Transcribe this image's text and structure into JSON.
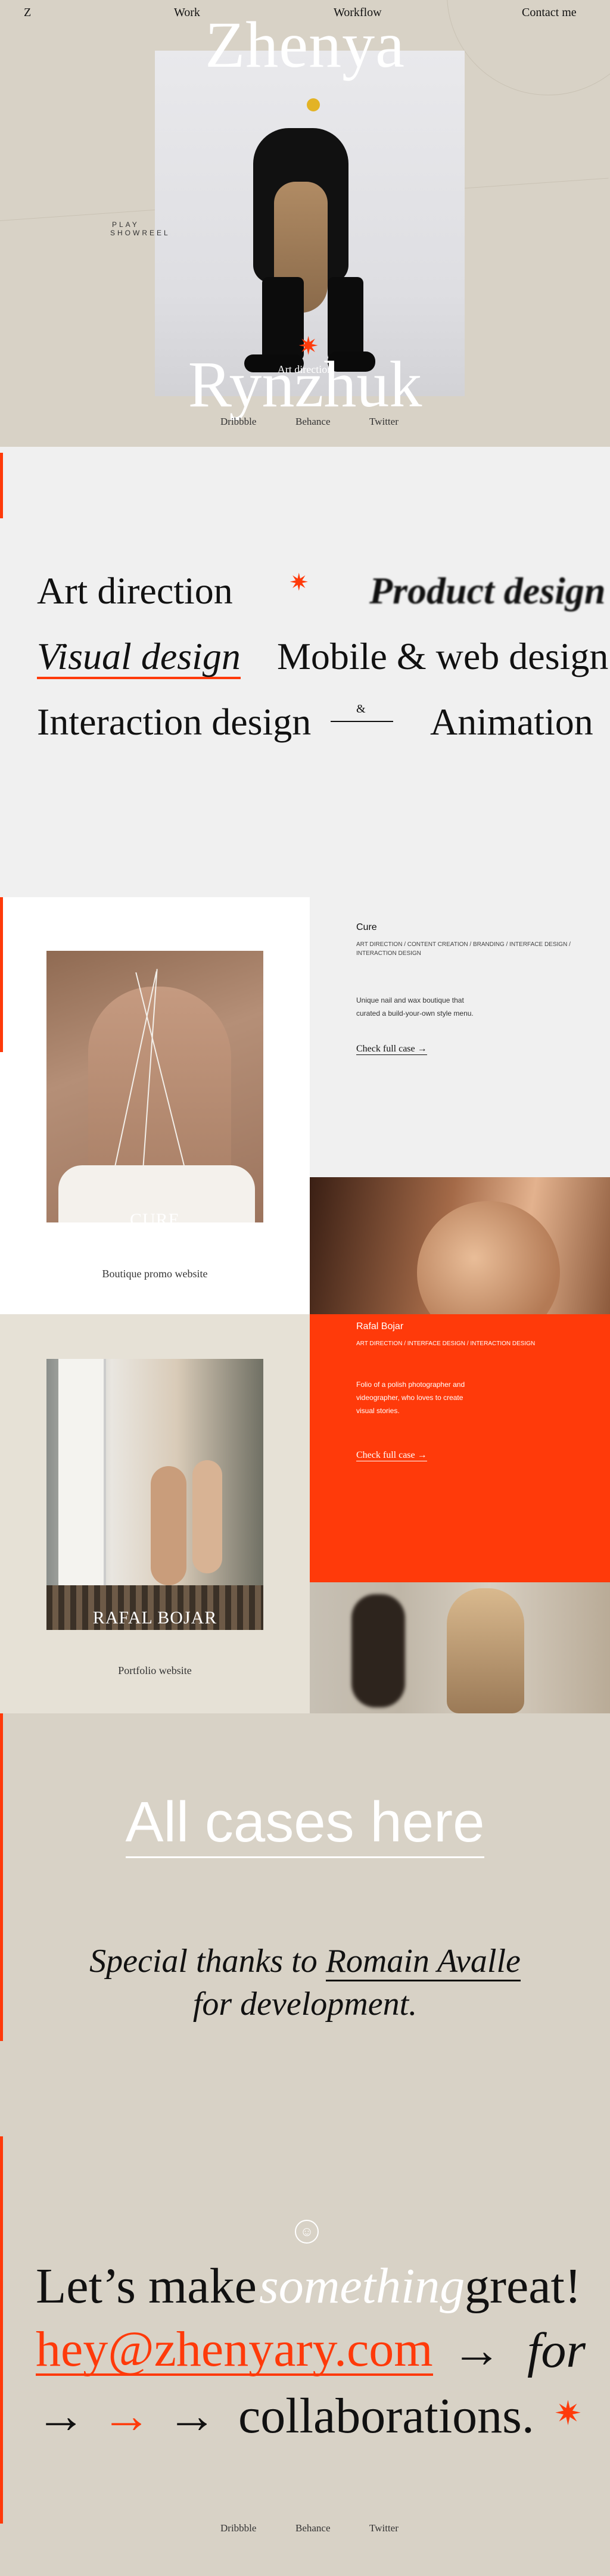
{
  "nav": {
    "logo": "Z",
    "work": "Work",
    "workflow": "Workflow",
    "contact": "Contact me"
  },
  "hero": {
    "first_name": "Zhenya",
    "last_name": "Rynzhuk",
    "role": "Art direction",
    "showreel_line1": "PLAY",
    "showreel_line2": "SHOWREEL",
    "social": [
      "Dribbble",
      "Behance",
      "Twitter"
    ],
    "star": "✷"
  },
  "skills": {
    "row1": [
      "Art direction",
      "Product design"
    ],
    "row2": [
      "Visual design",
      "Mobile & web design"
    ],
    "row3": [
      "Interaction design",
      "&",
      "Animation"
    ]
  },
  "cases": [
    {
      "photo_title": "CURE",
      "subtitle": "Boutique promo website",
      "title": "Cure",
      "tags": "ART DIRECTION / CONTENT CREATION / BRANDING / INTERFACE DESIGN / INTERACTION DESIGN",
      "description": "Unique nail and wax boutique that curated a build-your-own style menu.",
      "link": "Check full case →"
    },
    {
      "photo_title": "RAFAL BOJAR",
      "subtitle": "Portfolio website",
      "title": "Rafal Bojar",
      "tags": "ART DIRECTION / INTERFACE DESIGN / INTERACTION DESIGN",
      "description": "Folio of a polish photographer and videographer, who loves to create visual stories.",
      "link": "Check full case →"
    }
  ],
  "all_cases": "All cases here",
  "thanks": {
    "before": "Special thanks to ",
    "name": "Romain Avalle",
    "after": "for development."
  },
  "contact": {
    "smile": "☺",
    "lets": "Let’s make ",
    "something": "something",
    "great": " great!",
    "email": "hey@zhenyary.com",
    "arrow": "→",
    "for": "for",
    "collaborations": "collaborations."
  },
  "footer_social": [
    "Dribbble",
    "Behance",
    "Twitter"
  ],
  "colors": {
    "accent": "#ff3a0a",
    "beige": "#d8d2c6",
    "light": "#f0f0f0"
  }
}
